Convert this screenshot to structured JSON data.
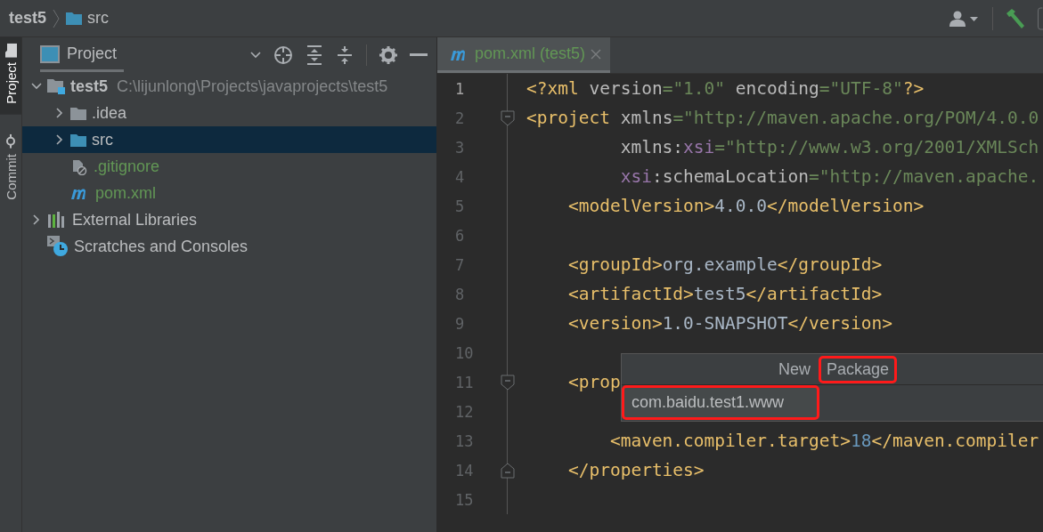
{
  "breadcrumb": [
    {
      "text": "test5",
      "kind": "project"
    },
    {
      "text": "src",
      "kind": "folder"
    }
  ],
  "tool_strip": [
    {
      "label": "Project",
      "selected": true
    },
    {
      "label": "Commit",
      "selected": false
    }
  ],
  "project_panel": {
    "title": "Project"
  },
  "tree": [
    {
      "name": "test5",
      "path": "C:\\lijunlong\\Projects\\javaprojects\\test5",
      "kind": "module",
      "expanded": true,
      "selected": false,
      "children": [
        {
          "name": ".idea",
          "kind": "folder",
          "expanded": false,
          "selected": false
        },
        {
          "name": "src",
          "kind": "source",
          "expanded": false,
          "selected": true
        },
        {
          "name": ".gitignore",
          "kind": "ignored",
          "selected": false
        },
        {
          "name": "pom.xml",
          "kind": "maven",
          "selected": false
        }
      ]
    },
    {
      "name": "External Libraries",
      "kind": "libraries",
      "expanded": false,
      "selected": false
    },
    {
      "name": "Scratches and Consoles",
      "kind": "scratches",
      "selected": false
    }
  ],
  "editor_tabs": [
    {
      "label": "pom.xml (test5)",
      "selected": true
    }
  ],
  "code": [
    {
      "number": "1",
      "fold_open": false,
      "fold_close": false,
      "tokens": [
        {
          "t": "<?xml ",
          "kind": "tag"
        },
        {
          "t": "version",
          "kind": "attr"
        },
        {
          "t": "=\"1.0\" ",
          "kind": "str"
        },
        {
          "t": "encoding",
          "kind": "attr"
        },
        {
          "t": "=\"UTF-8\"",
          "kind": "str"
        },
        {
          "t": "?>",
          "kind": "tag"
        }
      ]
    },
    {
      "number": "2",
      "fold_open": true,
      "fold_close": false,
      "tokens": [
        {
          "t": "<project ",
          "kind": "tag"
        },
        {
          "t": "xmlns",
          "kind": "attr"
        },
        {
          "t": "=\"http://maven.apache.org/POM/4.0.0",
          "kind": "str"
        }
      ]
    },
    {
      "number": "3",
      "fold_open": false,
      "fold_close": false,
      "tokens": [
        {
          "t": "         xmlns:",
          "kind": "attr"
        },
        {
          "t": "xsi",
          "kind": "ns"
        },
        {
          "t": "=\"http://www.w3.org/2001/XMLSch",
          "kind": "str"
        }
      ]
    },
    {
      "number": "4",
      "fold_open": false,
      "fold_close": false,
      "tokens": [
        {
          "t": "         xsi",
          "kind": "ns"
        },
        {
          "t": ":schemaLocation",
          "kind": "attr"
        },
        {
          "t": "=\"http://maven.apache.",
          "kind": "str"
        }
      ]
    },
    {
      "number": "5",
      "fold_open": false,
      "fold_close": false,
      "tokens": [
        {
          "t": "    <modelVersion>",
          "kind": "tag"
        },
        {
          "t": "4.0.0",
          "kind": "text"
        },
        {
          "t": "</modelVersion>",
          "kind": "tag"
        }
      ]
    },
    {
      "number": "6",
      "fold_open": false,
      "fold_close": false
    },
    {
      "number": "7",
      "fold_open": false,
      "fold_close": false,
      "tokens": [
        {
          "t": "    <groupId>",
          "kind": "tag"
        },
        {
          "t": "org.example",
          "kind": "text"
        },
        {
          "t": "</groupId>",
          "kind": "tag"
        }
      ]
    },
    {
      "number": "8",
      "fold_open": false,
      "fold_close": false,
      "tokens": [
        {
          "t": "    <artifactId>",
          "kind": "tag"
        },
        {
          "t": "test5",
          "kind": "text"
        },
        {
          "t": "</artifactId>",
          "kind": "tag"
        }
      ]
    },
    {
      "number": "9",
      "fold_open": false,
      "fold_close": false,
      "tokens": [
        {
          "t": "    <version>",
          "kind": "tag"
        },
        {
          "t": "1.0-SNAPSHOT",
          "kind": "text"
        },
        {
          "t": "</version>",
          "kind": "tag"
        }
      ]
    },
    {
      "number": "10",
      "fold_open": false,
      "fold_close": false
    },
    {
      "number": "11",
      "fold_open": true,
      "fold_close": false,
      "tokens": [
        {
          "t": "    <prop",
          "kind": "tag"
        }
      ]
    },
    {
      "number": "12",
      "fold_open": false,
      "fold_close": false
    },
    {
      "number": "13",
      "fold_open": false,
      "fold_close": false,
      "tokens": [
        {
          "t": "        <maven.compiler.target>",
          "kind": "tag"
        },
        {
          "t": "18",
          "kind": "num"
        },
        {
          "t": "</maven.compiler",
          "kind": "tag"
        }
      ]
    },
    {
      "number": "14",
      "fold_open": false,
      "fold_close": true,
      "tokens": [
        {
          "t": "    </properties>",
          "kind": "tag"
        }
      ]
    },
    {
      "number": "15",
      "fold_open": false,
      "fold_close": false
    }
  ],
  "popup": {
    "title": [
      {
        "text": "New",
        "highlighted": false
      },
      {
        "text": "Package",
        "highlighted": true
      }
    ],
    "field": {
      "value": "com.baidu.test1.www",
      "highlighted": true
    }
  }
}
